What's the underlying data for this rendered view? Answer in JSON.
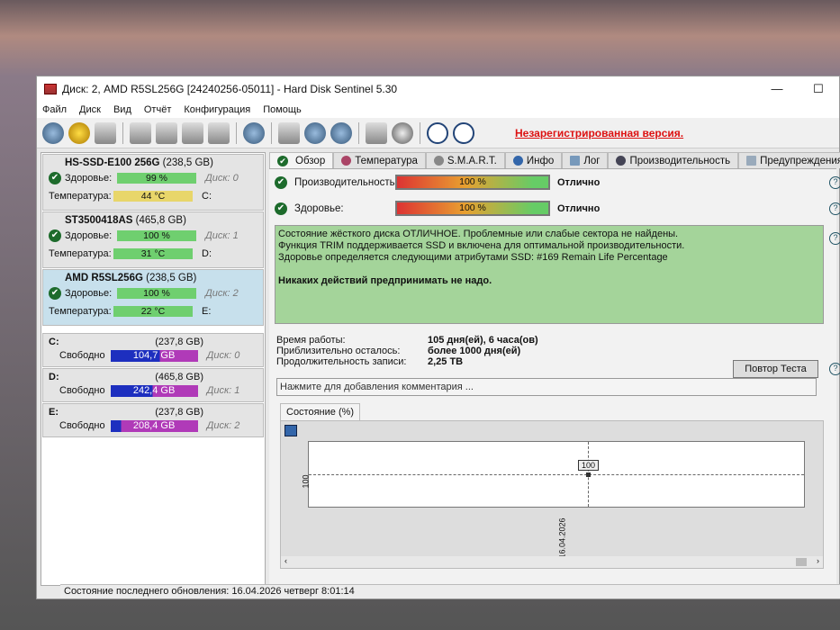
{
  "window": {
    "title": "Диск: 2, AMD R5SL256G [24240256-05011]  -  Hard Disk Sentinel 5.30",
    "minimize": "—",
    "maximize": "☐"
  },
  "menu": [
    "Файл",
    "Диск",
    "Вид",
    "Отчёт",
    "Конфигурация",
    "Помощь"
  ],
  "toolbar": {
    "unregistered": "Незарегистрированная версия."
  },
  "disks": [
    {
      "name": "HS-SSD-E100 256G",
      "size": "(238,5 GB)",
      "health_label": "Здоровье:",
      "health": "99 %",
      "temp_label": "Температура:",
      "temp": "44 °C",
      "disk": "Диск: 0",
      "vol": "C:"
    },
    {
      "name": "ST3500418AS",
      "size": "(465,8 GB)",
      "health_label": "Здоровье:",
      "health": "100 %",
      "temp_label": "Температура:",
      "temp": "31 °C",
      "disk": "Диск: 1",
      "vol": "D:"
    },
    {
      "name": "AMD R5SL256G",
      "size": "(238,5 GB)",
      "health_label": "Здоровье:",
      "health": "100 %",
      "temp_label": "Температура:",
      "temp": "22 °C",
      "disk": "Диск: 2",
      "vol": "E:"
    }
  ],
  "volumes": [
    {
      "name": "C:",
      "size": "(237,8 GB)",
      "free_label": "Свободно",
      "free": "104,7 GB",
      "used_pct": 56,
      "disk": "Диск: 0"
    },
    {
      "name": "D:",
      "size": "(465,8 GB)",
      "free_label": "Свободно",
      "free": "242,4 GB",
      "used_pct": 48,
      "disk": "Диск: 1"
    },
    {
      "name": "E:",
      "size": "(237,8 GB)",
      "free_label": "Свободно",
      "free": "208,4 GB",
      "used_pct": 12,
      "disk": "Диск: 2"
    }
  ],
  "tabs": [
    "Обзор",
    "Температура",
    "S.M.A.R.T.",
    "Инфо",
    "Лог",
    "Производительность",
    "Предупреждения"
  ],
  "overview": {
    "perf_label": "Производительность:",
    "perf": "100 %",
    "perf_status": "Отлично",
    "health_label": "Здоровье:",
    "health": "100 %",
    "health_status": "Отлично",
    "msg": [
      "Состояние жёсткого диска ОТЛИЧНОЕ. Проблемные или слабые сектора не найдены.",
      "Функция TRIM поддерживается SSD и включена для оптимальной производительности.",
      "Здоровье определяется следующими атрибутами SSD: #169 Remain Life Percentage"
    ],
    "msg_bold": "Никаких действий предпринимать не надо.",
    "stats": [
      [
        "Время работы:",
        "105 дня(ей), 6 часа(ов)"
      ],
      [
        "Приблизительно осталось:",
        "более 1000 дня(ей)"
      ],
      [
        "Продолжительность записи:",
        "2,25 TB"
      ]
    ],
    "retest": "Повтор Теста",
    "comment": "Нажмите для добавления комментария ..."
  },
  "chart_data": {
    "type": "line",
    "title": "Состояние (%)",
    "x": [
      "16.04.2026"
    ],
    "values": [
      100
    ],
    "ytick": "100",
    "point_label": "100"
  },
  "status": "Состояние последнего обновления: 16.04.2026 четверг 8:01:14"
}
